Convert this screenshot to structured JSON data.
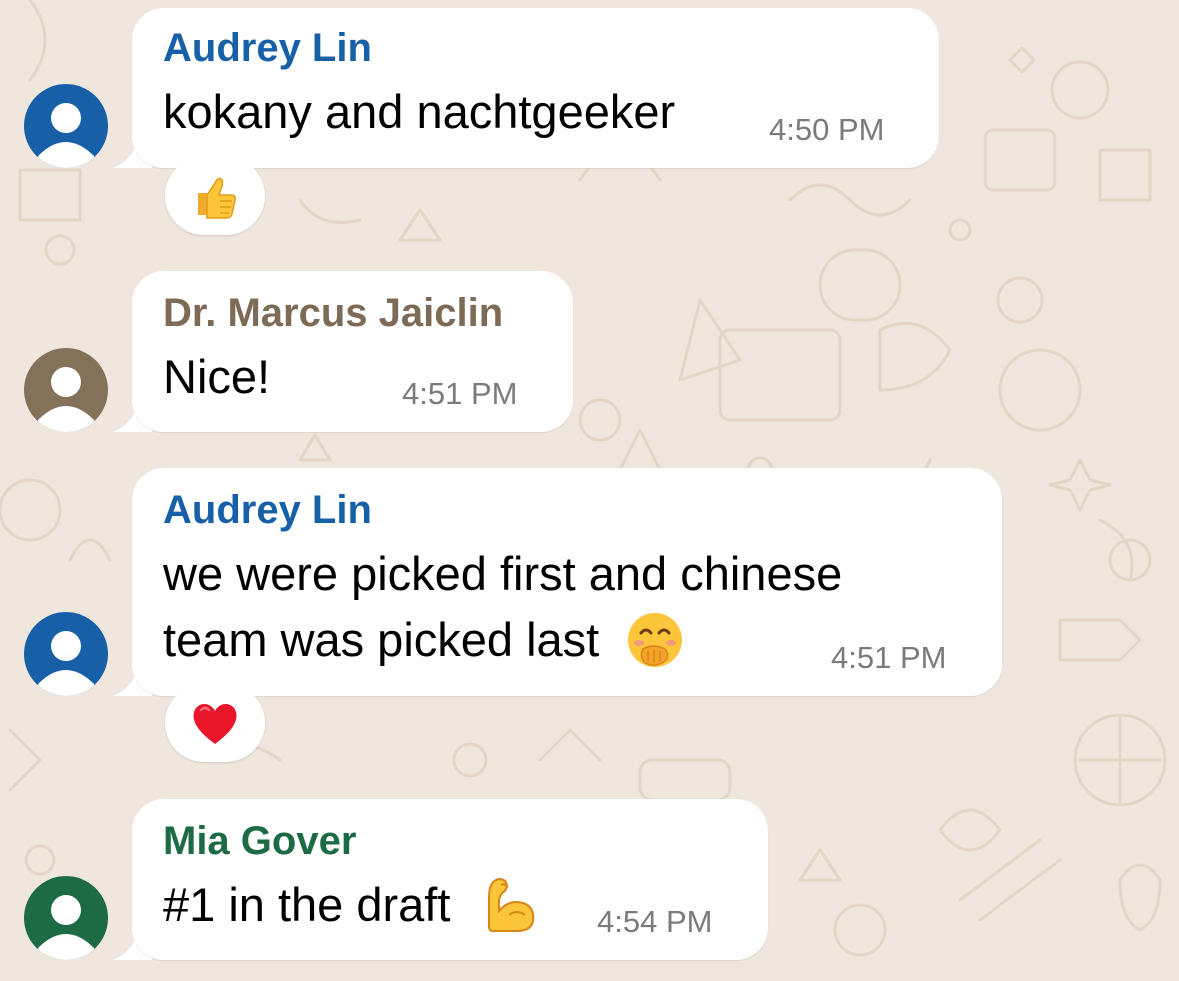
{
  "messages": [
    {
      "sender": "Audrey Lin",
      "sender_color": "#1760a8",
      "avatar_color": "#1760a8",
      "text": "kokany and nachtgeeker",
      "time": "4:50 PM",
      "reaction": "thumbs-up"
    },
    {
      "sender": "Dr. Marcus Jaiclin",
      "sender_color": "#7d6b57",
      "avatar_color": "#847159",
      "text": "Nice!",
      "time": "4:51 PM"
    },
    {
      "sender": "Audrey Lin",
      "sender_color": "#1760a8",
      "avatar_color": "#1760a8",
      "text_line1": "we were picked first and chinese",
      "text_line2": "team was picked last",
      "inline_emoji": "face-with-hand-over-mouth",
      "time": "4:51 PM",
      "reaction": "red-heart"
    },
    {
      "sender": "Mia Gover",
      "sender_color": "#1d6b45",
      "avatar_color": "#1d6b45",
      "text": "#1 in the draft",
      "inline_emoji": "flexed-biceps",
      "time": "4:54 PM"
    }
  ],
  "colors": {
    "wallpaper": "#efe7dd",
    "bubble": "#ffffff",
    "timestamp": "#7b7b7b"
  }
}
